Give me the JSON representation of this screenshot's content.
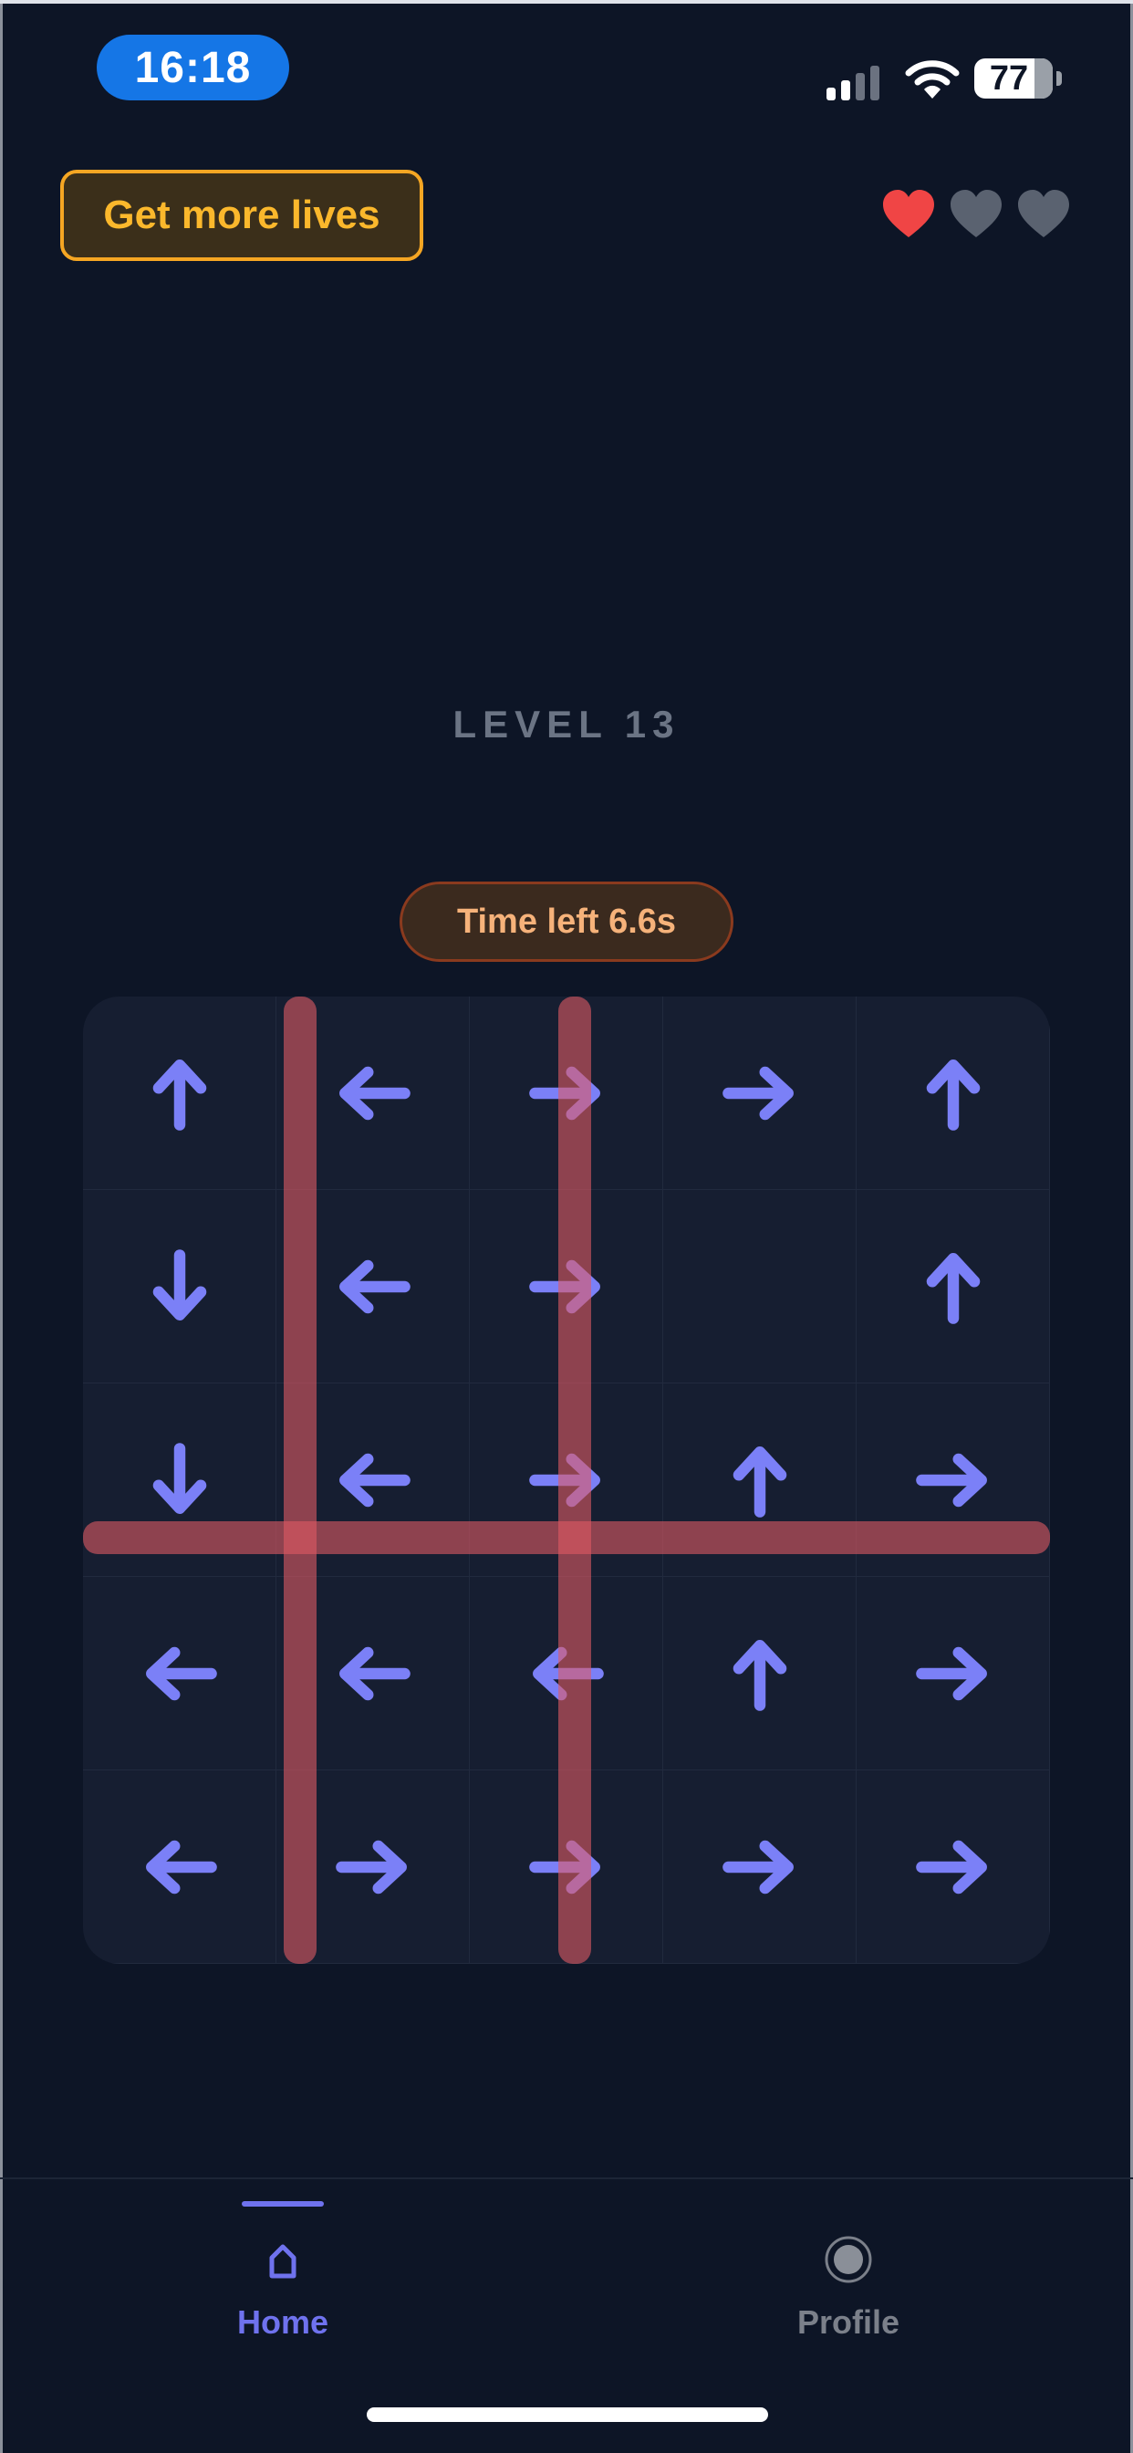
{
  "status_bar": {
    "time": "16:18",
    "battery": "77",
    "icons": [
      "cellular-signal-icon",
      "wifi-icon",
      "battery-icon"
    ]
  },
  "top": {
    "more_lives_label": "Get more lives",
    "hearts_total": 3,
    "hearts_filled": 1
  },
  "level": {
    "title": "LEVEL 13",
    "timer": "Time left 6.6s"
  },
  "board": {
    "rows": 5,
    "cols": 5,
    "grid": [
      [
        "up",
        "left",
        "right",
        "right",
        "up"
      ],
      [
        "down",
        "left",
        "right",
        "",
        "up"
      ],
      [
        "down",
        "left",
        "right",
        "up",
        "right"
      ],
      [
        "left",
        "left",
        "left",
        "up",
        "right"
      ],
      [
        "left",
        "right",
        "right",
        "right",
        "right"
      ]
    ],
    "lasers": {
      "vertical_columns": [
        1,
        2
      ],
      "horizontal_rows": [
        2
      ]
    }
  },
  "nav": {
    "items": [
      {
        "label": "Home",
        "icon": "home-icon",
        "active": true
      },
      {
        "label": "Profile",
        "icon": "profile-icon",
        "active": false
      }
    ]
  },
  "colors": {
    "background": "#0d1526",
    "arrow": "#7b80f7",
    "laser": "#e05a64",
    "heart_full": "#f04545",
    "heart_empty": "#5a6270",
    "accent": "#6f72ee",
    "warning": "#f5a623"
  }
}
